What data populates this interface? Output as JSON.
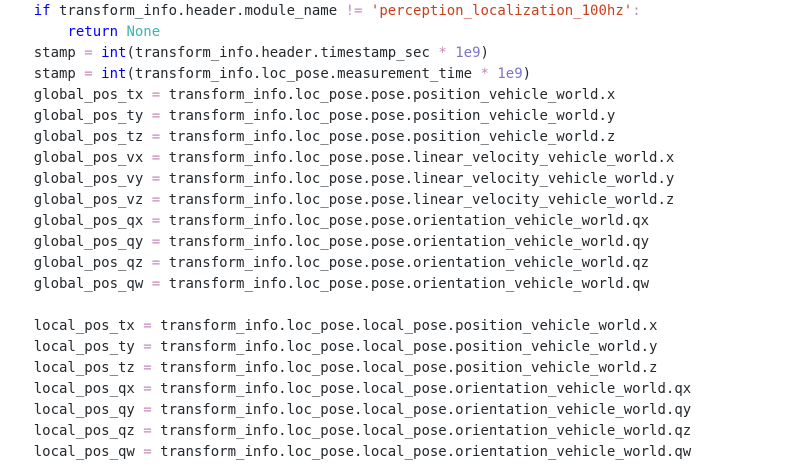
{
  "colors": {
    "background": "#ffffff",
    "text": "#24292e",
    "keyword": "#0000ff",
    "none": "#3ab5ae",
    "operator": "#c58ab8",
    "number": "#7c74cc",
    "string": "#c7411e"
  },
  "lines": [
    [
      {
        "t": "    "
      },
      {
        "t": "if",
        "c": "kw"
      },
      {
        "t": " transform_info.header.module_name "
      },
      {
        "t": "!=",
        "c": "op"
      },
      {
        "t": " "
      },
      {
        "t": "'perception_localization_100hz'",
        "c": "str"
      },
      {
        "t": ":",
        "c": "op"
      }
    ],
    [
      {
        "t": "        "
      },
      {
        "t": "return",
        "c": "kw"
      },
      {
        "t": " "
      },
      {
        "t": "None",
        "c": "none"
      }
    ],
    [
      {
        "t": "    stamp "
      },
      {
        "t": "=",
        "c": "op"
      },
      {
        "t": " "
      },
      {
        "t": "int",
        "c": "kw"
      },
      {
        "t": "(transform_info.header.timestamp_sec "
      },
      {
        "t": "*",
        "c": "op"
      },
      {
        "t": " "
      },
      {
        "t": "1e9",
        "c": "num"
      },
      {
        "t": ")"
      }
    ],
    [
      {
        "t": "    stamp "
      },
      {
        "t": "=",
        "c": "op"
      },
      {
        "t": " "
      },
      {
        "t": "int",
        "c": "kw"
      },
      {
        "t": "(transform_info.loc_pose.measurement_time "
      },
      {
        "t": "*",
        "c": "op"
      },
      {
        "t": " "
      },
      {
        "t": "1e9",
        "c": "num"
      },
      {
        "t": ")"
      }
    ],
    [
      {
        "t": "    global_pos_tx "
      },
      {
        "t": "=",
        "c": "op"
      },
      {
        "t": " transform_info.loc_pose.pose.position_vehicle_world.x"
      }
    ],
    [
      {
        "t": "    global_pos_ty "
      },
      {
        "t": "=",
        "c": "op"
      },
      {
        "t": " transform_info.loc_pose.pose.position_vehicle_world.y"
      }
    ],
    [
      {
        "t": "    global_pos_tz "
      },
      {
        "t": "=",
        "c": "op"
      },
      {
        "t": " transform_info.loc_pose.pose.position_vehicle_world.z"
      }
    ],
    [
      {
        "t": "    global_pos_vx "
      },
      {
        "t": "=",
        "c": "op"
      },
      {
        "t": " transform_info.loc_pose.pose.linear_velocity_vehicle_world.x"
      }
    ],
    [
      {
        "t": "    global_pos_vy "
      },
      {
        "t": "=",
        "c": "op"
      },
      {
        "t": " transform_info.loc_pose.pose.linear_velocity_vehicle_world.y"
      }
    ],
    [
      {
        "t": "    global_pos_vz "
      },
      {
        "t": "=",
        "c": "op"
      },
      {
        "t": " transform_info.loc_pose.pose.linear_velocity_vehicle_world.z"
      }
    ],
    [
      {
        "t": "    global_pos_qx "
      },
      {
        "t": "=",
        "c": "op"
      },
      {
        "t": " transform_info.loc_pose.pose.orientation_vehicle_world.qx"
      }
    ],
    [
      {
        "t": "    global_pos_qy "
      },
      {
        "t": "=",
        "c": "op"
      },
      {
        "t": " transform_info.loc_pose.pose.orientation_vehicle_world.qy"
      }
    ],
    [
      {
        "t": "    global_pos_qz "
      },
      {
        "t": "=",
        "c": "op"
      },
      {
        "t": " transform_info.loc_pose.pose.orientation_vehicle_world.qz"
      }
    ],
    [
      {
        "t": "    global_pos_qw "
      },
      {
        "t": "=",
        "c": "op"
      },
      {
        "t": " transform_info.loc_pose.pose.orientation_vehicle_world.qw"
      }
    ],
    [],
    [
      {
        "t": "    local_pos_tx "
      },
      {
        "t": "=",
        "c": "op"
      },
      {
        "t": " transform_info.loc_pose.local_pose.position_vehicle_world.x"
      }
    ],
    [
      {
        "t": "    local_pos_ty "
      },
      {
        "t": "=",
        "c": "op"
      },
      {
        "t": " transform_info.loc_pose.local_pose.position_vehicle_world.y"
      }
    ],
    [
      {
        "t": "    local_pos_tz "
      },
      {
        "t": "=",
        "c": "op"
      },
      {
        "t": " transform_info.loc_pose.local_pose.position_vehicle_world.z"
      }
    ],
    [
      {
        "t": "    local_pos_qx "
      },
      {
        "t": "=",
        "c": "op"
      },
      {
        "t": " transform_info.loc_pose.local_pose.orientation_vehicle_world.qx"
      }
    ],
    [
      {
        "t": "    local_pos_qy "
      },
      {
        "t": "=",
        "c": "op"
      },
      {
        "t": " transform_info.loc_pose.local_pose.orientation_vehicle_world.qy"
      }
    ],
    [
      {
        "t": "    local_pos_qz "
      },
      {
        "t": "=",
        "c": "op"
      },
      {
        "t": " transform_info.loc_pose.local_pose.orientation_vehicle_world.qz"
      }
    ],
    [
      {
        "t": "    local_pos_qw "
      },
      {
        "t": "=",
        "c": "op"
      },
      {
        "t": " transform_info.loc_pose.local_pose.orientation_vehicle_world.qw"
      }
    ]
  ]
}
